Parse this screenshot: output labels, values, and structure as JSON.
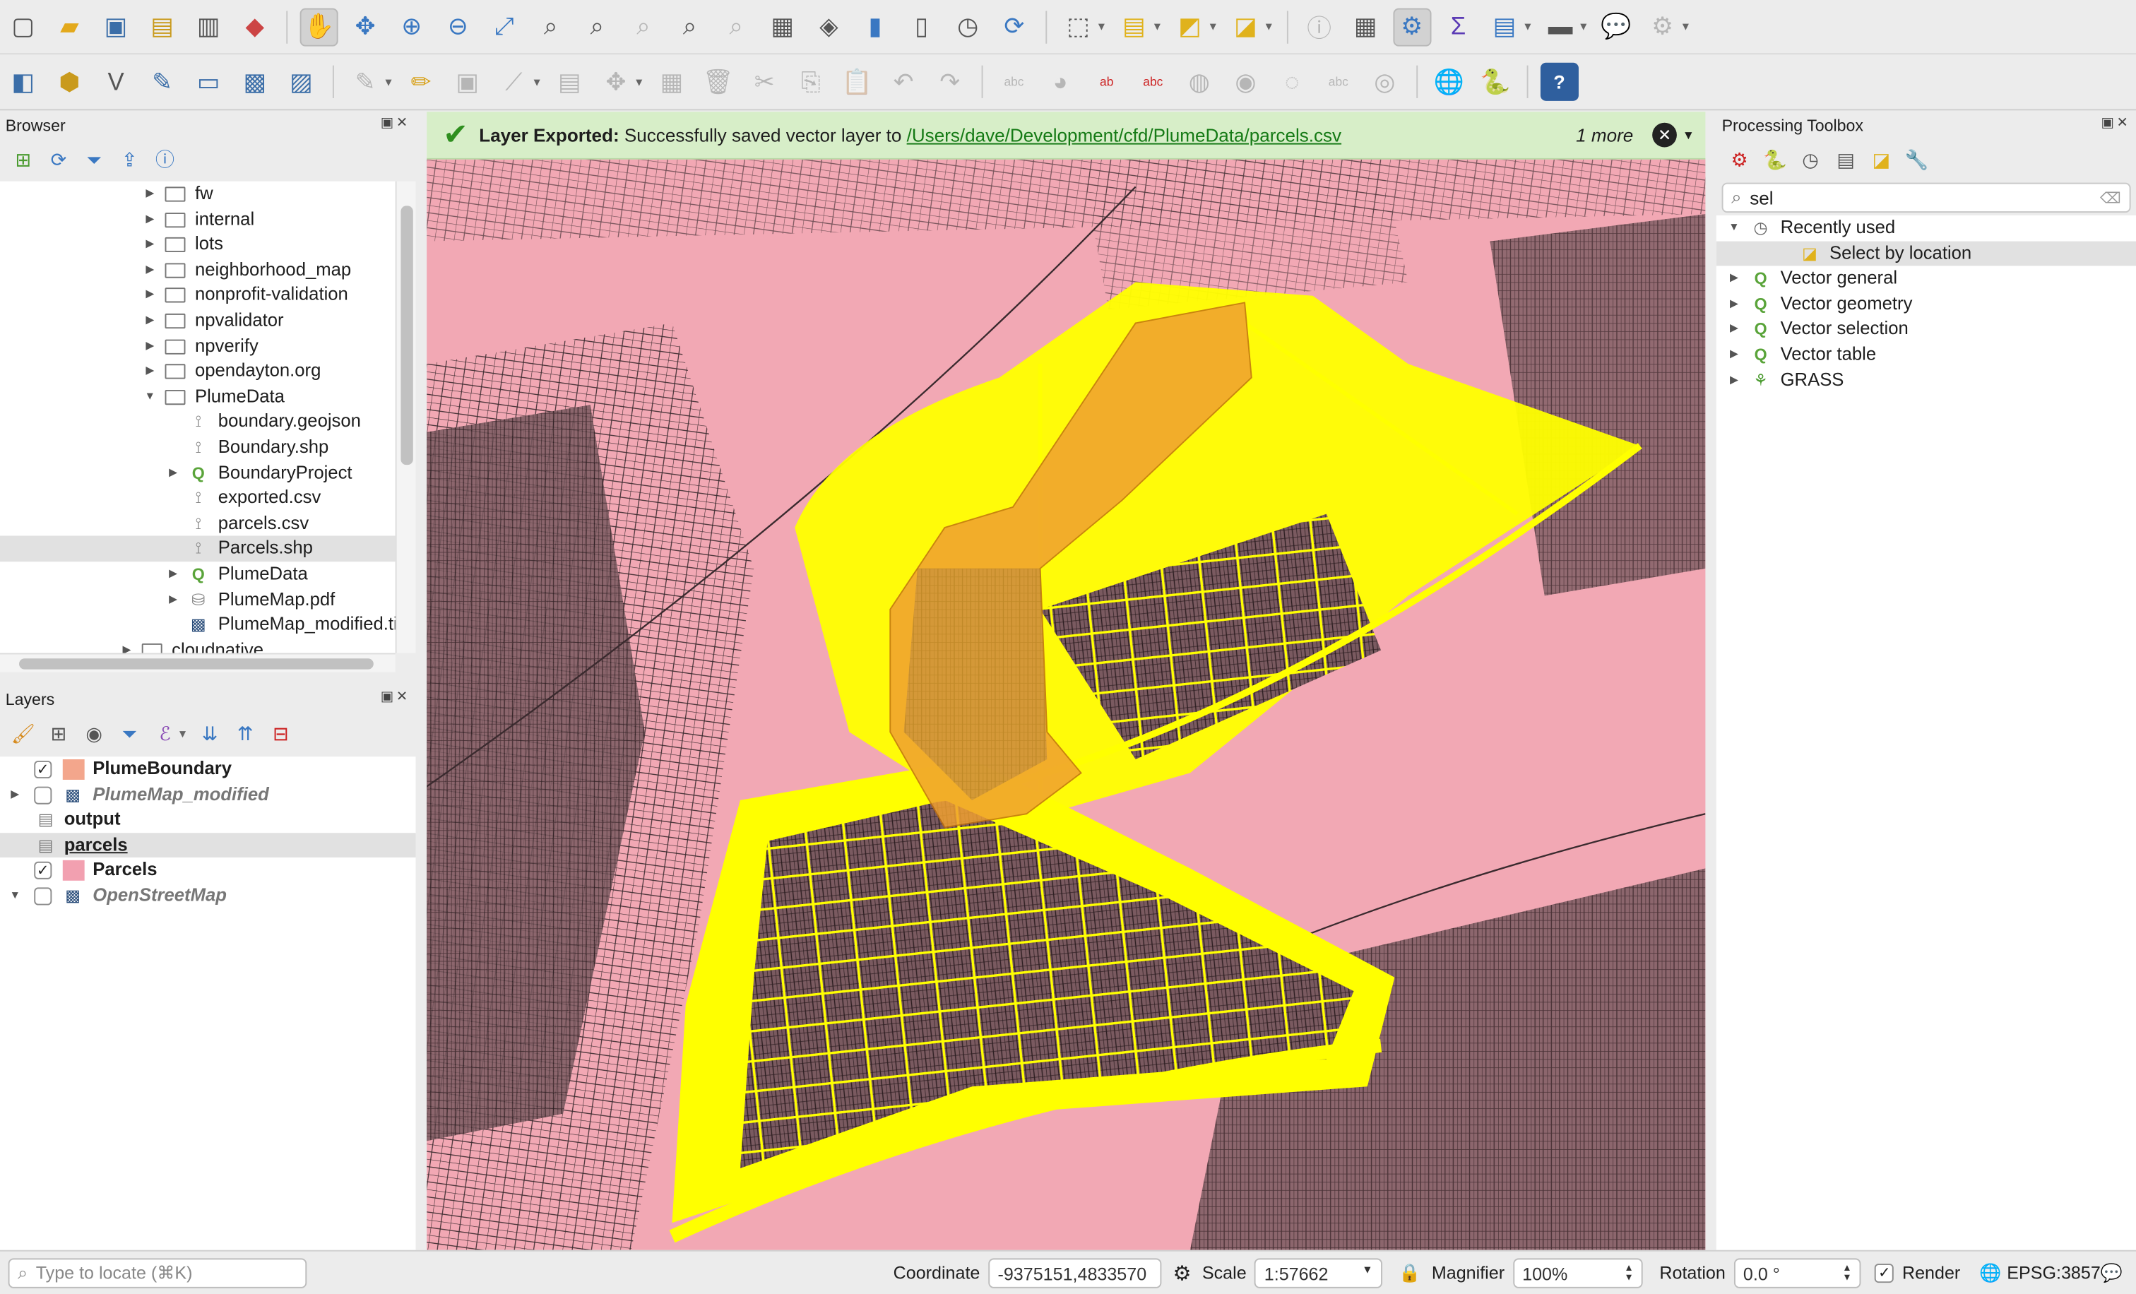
{
  "browser": {
    "title": "Browser",
    "items": [
      {
        "label": "fw",
        "depth": 1,
        "type": "folder",
        "expander": "collapsed"
      },
      {
        "label": "internal",
        "depth": 1,
        "type": "folder",
        "expander": "collapsed"
      },
      {
        "label": "lots",
        "depth": 1,
        "type": "folder",
        "expander": "collapsed"
      },
      {
        "label": "neighborhood_map",
        "depth": 1,
        "type": "folder",
        "expander": "collapsed"
      },
      {
        "label": "nonprofit-validation",
        "depth": 1,
        "type": "folder",
        "expander": "collapsed"
      },
      {
        "label": "npvalidator",
        "depth": 1,
        "type": "folder",
        "expander": "collapsed"
      },
      {
        "label": "npverify",
        "depth": 1,
        "type": "folder",
        "expander": "collapsed"
      },
      {
        "label": "opendayton.org",
        "depth": 1,
        "type": "folder",
        "expander": "collapsed"
      },
      {
        "label": "PlumeData",
        "depth": 1,
        "type": "folder",
        "expander": "expanded"
      },
      {
        "label": "boundary.geojson",
        "depth": 2,
        "type": "vector",
        "expander": "none"
      },
      {
        "label": "Boundary.shp",
        "depth": 2,
        "type": "vector",
        "expander": "none"
      },
      {
        "label": "BoundaryProject",
        "depth": 2,
        "type": "qgis",
        "expander": "collapsed"
      },
      {
        "label": "exported.csv",
        "depth": 2,
        "type": "vector",
        "expander": "none"
      },
      {
        "label": "parcels.csv",
        "depth": 2,
        "type": "vector",
        "expander": "none"
      },
      {
        "label": "Parcels.shp",
        "depth": 2,
        "type": "vector",
        "expander": "none",
        "selected": true
      },
      {
        "label": "PlumeData",
        "depth": 2,
        "type": "qgis",
        "expander": "collapsed"
      },
      {
        "label": "PlumeMap.pdf",
        "depth": 2,
        "type": "db",
        "expander": "collapsed"
      },
      {
        "label": "PlumeMap_modified.tif",
        "depth": 2,
        "type": "raster",
        "expander": "none"
      },
      {
        "label": "cloudnative",
        "depth": 0,
        "type": "folder",
        "expander": "collapsed"
      }
    ]
  },
  "layers": {
    "title": "Layers",
    "items": [
      {
        "label": "PlumeBoundary",
        "checked": true,
        "style": "bold",
        "symbol": "fill",
        "color": "#f3a68c",
        "expander": "none"
      },
      {
        "label": "PlumeMap_modified",
        "checked": false,
        "style": "italic",
        "symbol": "raster",
        "expander": "collapsed"
      },
      {
        "label": "output",
        "checked": null,
        "style": "bold",
        "symbol": "table",
        "expander": "none"
      },
      {
        "label": "parcels",
        "checked": null,
        "style": "underline",
        "symbol": "table",
        "expander": "none",
        "selected": true
      },
      {
        "label": "Parcels",
        "checked": true,
        "style": "bold",
        "symbol": "fill",
        "color": "#f2a0b0",
        "expander": "none"
      },
      {
        "label": "OpenStreetMap",
        "checked": false,
        "style": "italic",
        "symbol": "raster",
        "expander": "expanded"
      }
    ]
  },
  "message": {
    "title": "Layer Exported:",
    "text": "Successfully saved vector layer to",
    "link": "/Users/dave/Development/cfd/PlumeData/parcels.csv",
    "more": "1 more"
  },
  "toolbox": {
    "title": "Processing Toolbox",
    "search_value": "sel",
    "items": [
      {
        "label": "Recently used",
        "depth": 0,
        "icon": "clock-icon",
        "expander": "expanded"
      },
      {
        "label": "Select by location",
        "depth": 1,
        "icon": "select-location-icon",
        "expander": "none",
        "selected": true
      },
      {
        "label": "Vector general",
        "depth": 0,
        "icon": "qgis-icon",
        "expander": "collapsed"
      },
      {
        "label": "Vector geometry",
        "depth": 0,
        "icon": "qgis-icon",
        "expander": "collapsed"
      },
      {
        "label": "Vector selection",
        "depth": 0,
        "icon": "qgis-icon",
        "expander": "collapsed"
      },
      {
        "label": "Vector table",
        "depth": 0,
        "icon": "qgis-icon",
        "expander": "collapsed"
      },
      {
        "label": "GRASS",
        "depth": 0,
        "icon": "grass-icon",
        "expander": "collapsed"
      }
    ]
  },
  "status": {
    "locator_placeholder": "Type to locate (⌘K)",
    "coordinate_label": "Coordinate",
    "coordinate_value": "-9375151,4833570",
    "scale_label": "Scale",
    "scale_value": "1:57662",
    "magnifier_label": "Magnifier",
    "magnifier_value": "100%",
    "rotation_label": "Rotation",
    "rotation_value": "0.0 °",
    "render_label": "Render",
    "render_checked": true,
    "crs": "EPSG:3857"
  },
  "colors": {
    "parcel_fill": "#f2a8b4",
    "selection": "#ffff00",
    "plume": "#f0a030",
    "message_bg": "#d7eec8"
  }
}
